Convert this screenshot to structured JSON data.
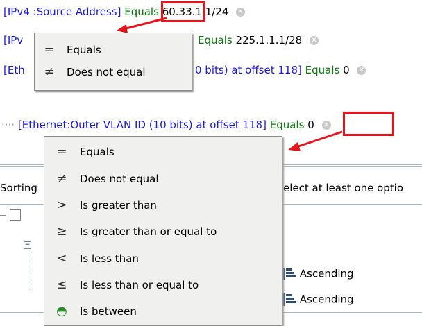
{
  "top": {
    "rows": [
      {
        "field": "[IPv4 :Source Address]",
        "operator": "Equals",
        "value": "60.33.1.1/24"
      },
      {
        "field": "[IPv",
        "operator": "Equals",
        "value": "225.1.1.1/28"
      },
      {
        "field": "[Eth",
        "tail": "0 bits) at offset 118]",
        "operator": "Equals",
        "value": "0"
      }
    ],
    "menu": [
      {
        "icon": "=",
        "label": "Equals"
      },
      {
        "icon": "≠",
        "label": "Does not equal"
      }
    ]
  },
  "bottom": {
    "row": {
      "prefix": "····",
      "field": "[Ethernet:Outer VLAN ID (10 bits) at offset 118]",
      "operator": "Equals",
      "value": "0"
    },
    "sorting_label": "Sorting",
    "hint_text": "elect at least one optio",
    "tree_rows": [
      {
        "sort": "Ascending"
      },
      {
        "sort": "Ascending"
      }
    ],
    "menu": [
      {
        "icon": "=",
        "label": "Equals"
      },
      {
        "icon": "≠",
        "label": "Does not equal"
      },
      {
        "icon": ">",
        "label": "Is greater than"
      },
      {
        "icon": "≥",
        "label": "Is greater than or equal to"
      },
      {
        "icon": "<",
        "label": "Is less than"
      },
      {
        "icon": "≤",
        "label": "Is less than or equal to"
      },
      {
        "icon": "◓",
        "label": "Is between"
      }
    ]
  },
  "colors": {
    "highlight": "#e8141c",
    "field": "#1a1adf",
    "operator": "#0a7a0a"
  }
}
